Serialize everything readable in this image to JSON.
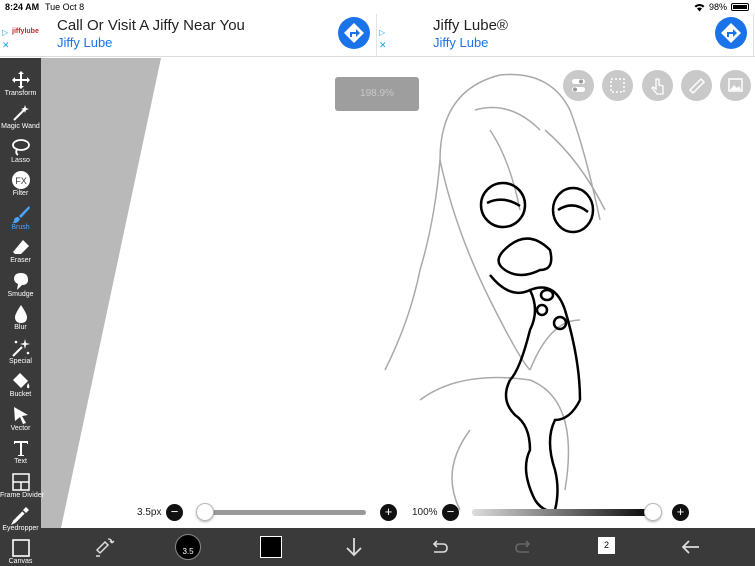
{
  "status_bar": {
    "time": "8:24 AM",
    "date": "Tue Oct 8",
    "battery": "98%",
    "icons": [
      "wifi-icon",
      "battery-icon"
    ]
  },
  "ads": [
    {
      "logo": "jiffylube",
      "title": "Call Or Visit A Jiffy Near You",
      "subtitle": "Jiffy Lube",
      "icon": "directions-arrow-icon"
    },
    {
      "title": "Jiffy Lube®",
      "subtitle": "Jiffy Lube",
      "icon": "directions-arrow-icon"
    }
  ],
  "toolbar": {
    "active_tool": "Brush",
    "tools": [
      {
        "label": "Transform",
        "icon": "move-arrows-icon"
      },
      {
        "label": "Magic Wand",
        "icon": "magic-wand-icon"
      },
      {
        "label": "Lasso",
        "icon": "lasso-icon"
      },
      {
        "label": "Filter",
        "icon": "fx-icon"
      },
      {
        "label": "Brush",
        "icon": "brush-icon"
      },
      {
        "label": "Eraser",
        "icon": "eraser-icon"
      },
      {
        "label": "Smudge",
        "icon": "smudge-icon"
      },
      {
        "label": "Blur",
        "icon": "drop-icon"
      },
      {
        "label": "Special",
        "icon": "sparkle-wand-icon"
      },
      {
        "label": "Bucket",
        "icon": "bucket-icon"
      },
      {
        "label": "Vector",
        "icon": "cursor-icon"
      },
      {
        "label": "Text",
        "icon": "text-icon"
      },
      {
        "label": "Frame Divider",
        "icon": "frame-divider-icon"
      },
      {
        "label": "Eyedropper",
        "icon": "eyedropper-icon"
      },
      {
        "label": "Canvas",
        "icon": "canvas-icon"
      }
    ]
  },
  "canvas": {
    "zoom_label": "198.9%",
    "top_buttons": [
      "toggle-icon",
      "selection-icon",
      "touch-icon",
      "ruler-icon",
      "image-icon"
    ]
  },
  "brush_size": {
    "label": "3.5px",
    "level_fraction": 0.03
  },
  "opacity": {
    "label": "100%",
    "level_fraction": 1.0
  },
  "bottom_bar": {
    "color_ball_label": "3.5",
    "layers_count": "2",
    "icons": [
      "swap-brush-icon",
      "brush-color-icon",
      "color-swatch-icon",
      "down-arrow-icon",
      "undo-icon",
      "redo-icon",
      "layers-icon",
      "back-arrow-icon"
    ]
  },
  "colors": {
    "accent": "#1a73e8",
    "toolbar_bg": "#3a3a3a",
    "canvas_bg": "#ffffff",
    "wedge": "#b9b9b9"
  }
}
